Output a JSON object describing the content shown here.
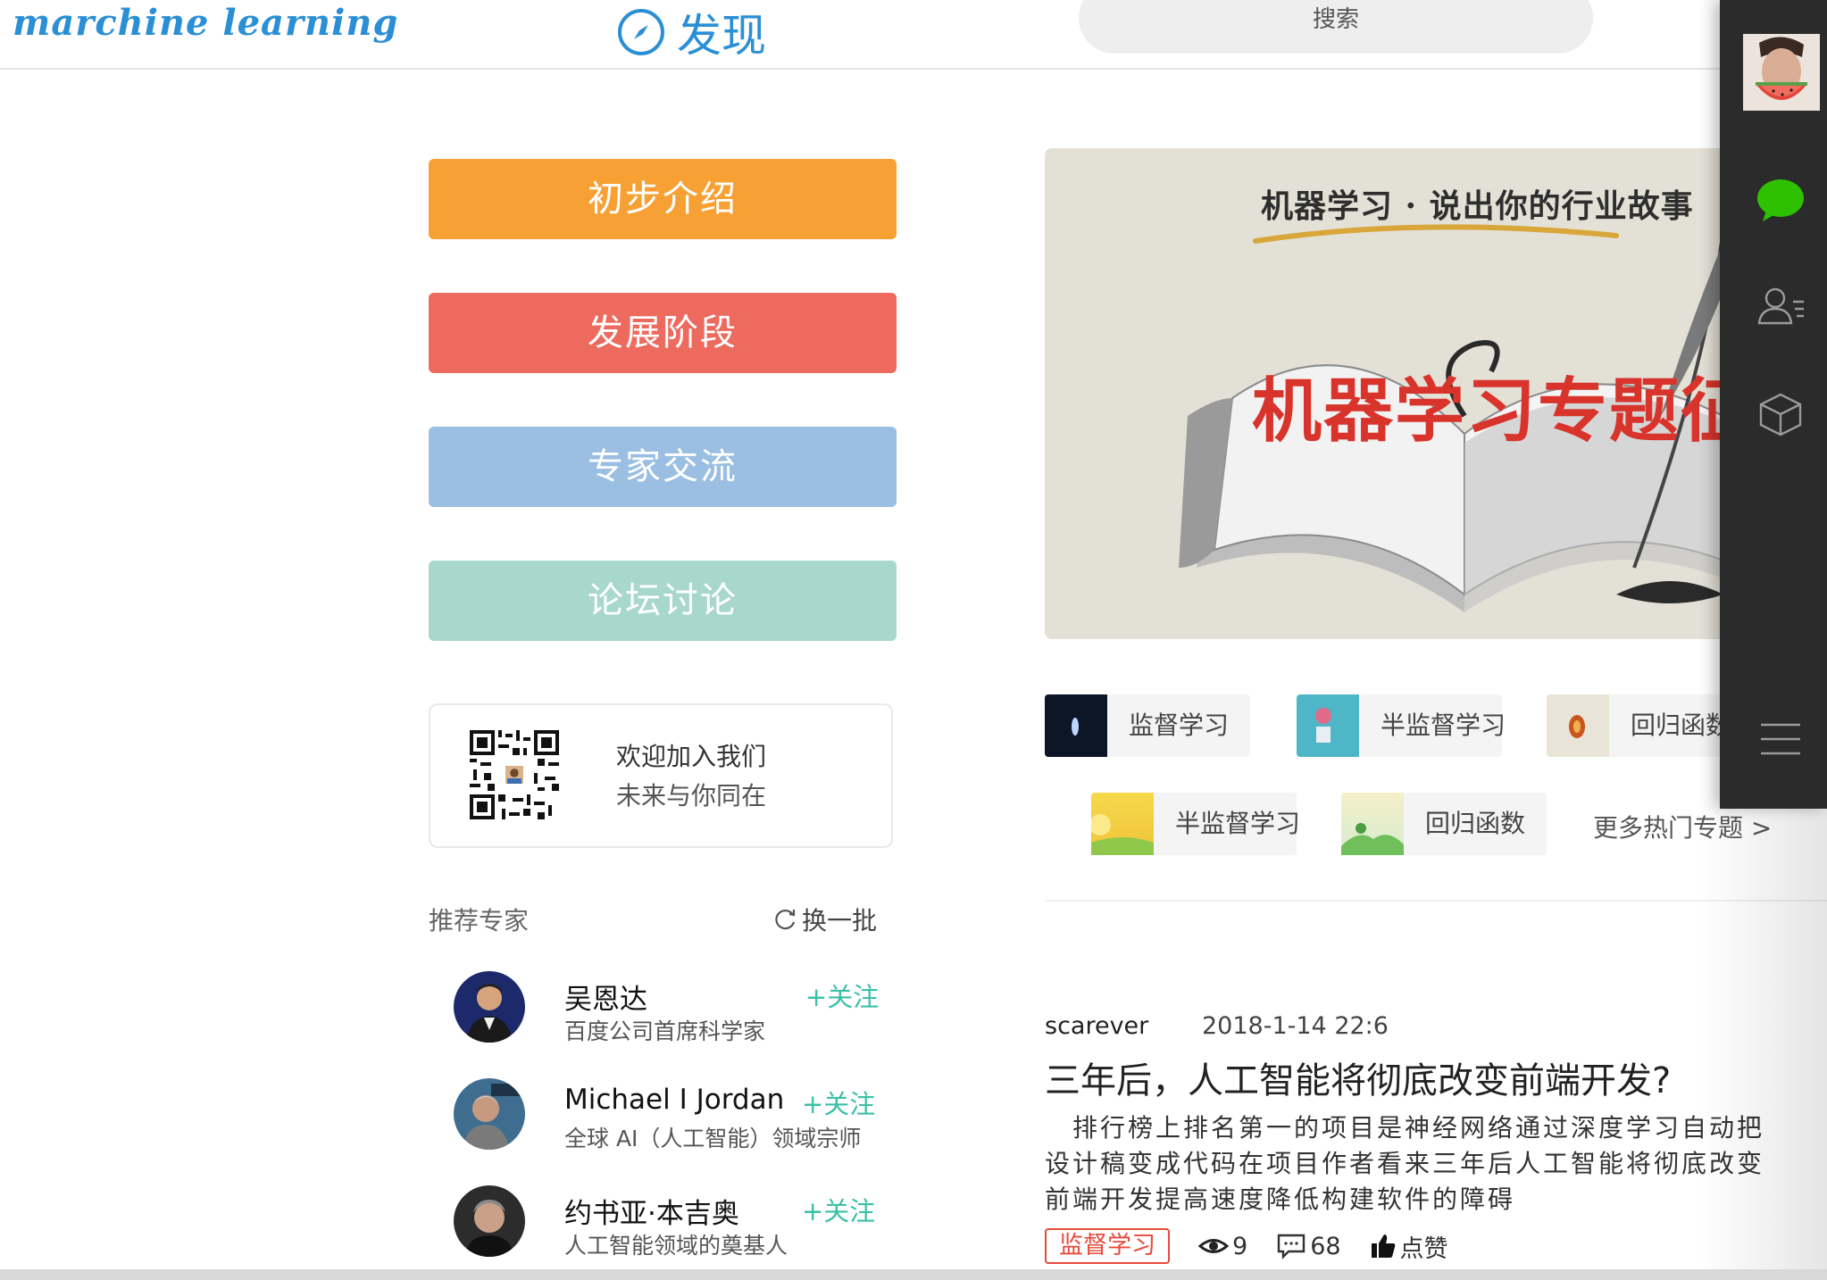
{
  "header": {
    "logo": "marchine learning",
    "discover_label": "发现",
    "search_placeholder": "搜索"
  },
  "categories": [
    {
      "label": "初步介绍",
      "color": "#f7a033"
    },
    {
      "label": "发展阶段",
      "color": "#ec6a5e"
    },
    {
      "label": "专家交流",
      "color": "#9abfe2"
    },
    {
      "label": "论坛讨论",
      "color": "#a8d8cc"
    }
  ],
  "join": {
    "line1": "欢迎加入我们",
    "line2": "未来与你同在"
  },
  "recommend": {
    "title": "推荐专家",
    "refresh": "换一批",
    "experts": [
      {
        "name": "吴恩达",
        "desc": "百度公司首席科学家",
        "follow": "+关注"
      },
      {
        "name": "Michael I Jordan",
        "desc": "全球 AI（人工智能）领域宗师",
        "follow": "+关注"
      },
      {
        "name": "约书亚·本吉奥",
        "desc": "人工智能领域的奠基人",
        "follow": "+关注"
      }
    ]
  },
  "banner": {
    "top_text": "机器学习 · 说出你的行业故事",
    "main_text": "机器学习专题征文"
  },
  "topics": [
    {
      "label": "监督学习",
      "thumb": "#0c1626"
    },
    {
      "label": "半监督学习",
      "thumb": "#4fb6c8"
    },
    {
      "label": "回归函数",
      "thumb": "#e8e4d7"
    },
    {
      "label": "半监督学习",
      "thumb": "#f3d34e"
    },
    {
      "label": "回归函数",
      "thumb": "#cfe6b6"
    }
  ],
  "more_topics": "更多热门专题 >",
  "article": {
    "author": "scarever",
    "date": "2018-1-14 22:6",
    "title": "三年后，人工智能将彻底改变前端开发?",
    "body": "　排行榜上排名第一的项目是神经网络通过深度学习自动把设计稿变成代码在项目作者看来三年后人工智能将彻底改变前端开发提高速度降低构建软件的障碍",
    "tag": "监督学习",
    "views": "9",
    "comments": "68",
    "like": "点赞"
  },
  "colors": {
    "accent": "#2b8fd6",
    "follow": "#3cc0a7",
    "tag_red": "#e64a3b",
    "dock": "#2b2b2b",
    "wechat_green": "#2dc100"
  },
  "dock_icons": [
    "avatar",
    "chat-icon",
    "contacts-icon",
    "box-icon",
    "menu-icon"
  ]
}
